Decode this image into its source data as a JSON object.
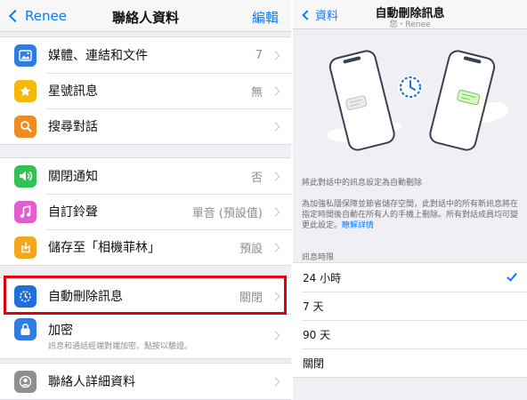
{
  "left": {
    "back_label": "Renee",
    "title": "聯絡人資料",
    "edit_label": "編輯",
    "groups": [
      [
        {
          "label": "媒體、連結和文件",
          "value": "7",
          "icon": "photo-icon",
          "color": "#2f7de1"
        },
        {
          "label": "星號訊息",
          "value": "無",
          "icon": "star-icon",
          "color": "#f5b80b"
        },
        {
          "label": "搜尋對話",
          "value": "",
          "icon": "search-icon",
          "color": "#f08c1e"
        }
      ],
      [
        {
          "label": "關閉通知",
          "value": "否",
          "icon": "speaker-icon",
          "color": "#35c152"
        },
        {
          "label": "自訂鈴聲",
          "value": "單音 (預設值)",
          "icon": "music-note-icon",
          "color": "#e35cd0"
        },
        {
          "label": "儲存至「相機菲林」",
          "value": "預設",
          "icon": "download-icon",
          "color": "#f3a71e"
        }
      ],
      [
        {
          "label": "自動刪除訊息",
          "value": "關閉",
          "icon": "timer-icon",
          "color": "#1f6fd9"
        },
        {
          "label": "加密",
          "sub": "訊息和通話經端對端加密。點按以驗證。",
          "icon": "lock-icon",
          "color": "#2f7de1"
        }
      ],
      [
        {
          "label": "聯絡人詳細資料",
          "value": "",
          "icon": "contact-icon",
          "color": "#8e8e93"
        }
      ]
    ]
  },
  "right": {
    "back_label": "資料",
    "title": "自動刪除訊息",
    "subtitle": "您・Renee",
    "caption_1": "將此對話中的訊息設定為自動刪除",
    "caption_2": "為加強私隱保障並節省儲存空間，此對話中的所有新訊息將在指定時間後自動在所有人的手機上刪除。所有對話成員均可變更此設定。",
    "caption_link": "瞭解詳情",
    "section_label": "訊息時限",
    "options": [
      {
        "label": "24 小時",
        "selected": true
      },
      {
        "label": "7 天",
        "selected": false
      },
      {
        "label": "90 天",
        "selected": false
      },
      {
        "label": "關閉",
        "selected": false
      }
    ],
    "accent": "#0a7aff"
  }
}
